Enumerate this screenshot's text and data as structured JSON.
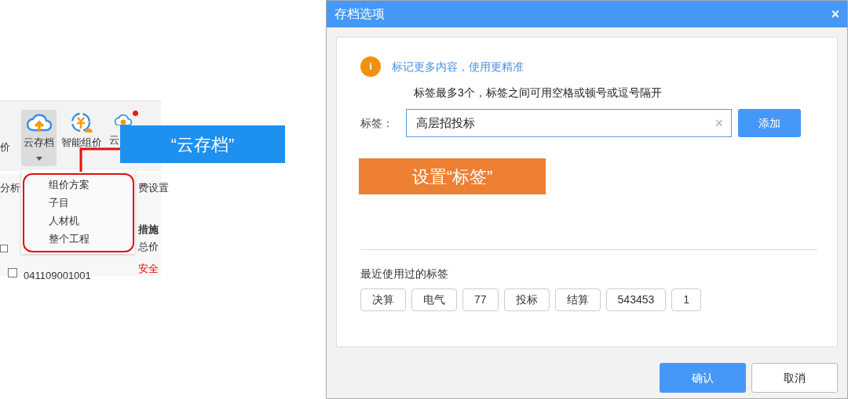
{
  "toolbar": {
    "left_label": "价",
    "buttons": [
      {
        "label": "云存档",
        "pressed": true,
        "dropdown": true
      },
      {
        "label": "智能组价",
        "pressed": false
      },
      {
        "label": "云",
        "pressed": false,
        "badge": true
      }
    ]
  },
  "dropdown_menu": {
    "items": [
      "组价方案",
      "子目",
      "人材机",
      "整个工程"
    ]
  },
  "background_labels": [
    "分析",
    "费设置",
    "措施",
    "总价",
    "安全",
    "041109001001"
  ],
  "callouts": [
    {
      "text": "“云存档”",
      "color": "#1e90f0"
    },
    {
      "text": "设置“标签”",
      "color": "#ee8033"
    }
  ],
  "dialog": {
    "title": "存档选项",
    "close": "×",
    "info_icon": "i",
    "info": "标记更多内容，使用更精准",
    "hint": "标签最多3个，标签之间可用空格或顿号或逗号隔开",
    "tag_label": "标签：",
    "tag_input": {
      "value": "高层招投标",
      "clear": "×"
    },
    "add_button": "添加",
    "recent_title": "最近使用过的标签",
    "recent_tags": [
      "决算",
      "电气",
      "77",
      "投标",
      "结算",
      "543453",
      "1"
    ],
    "buttons": [
      {
        "label": "确认",
        "primary": true
      },
      {
        "label": "取消",
        "primary": false
      }
    ]
  }
}
